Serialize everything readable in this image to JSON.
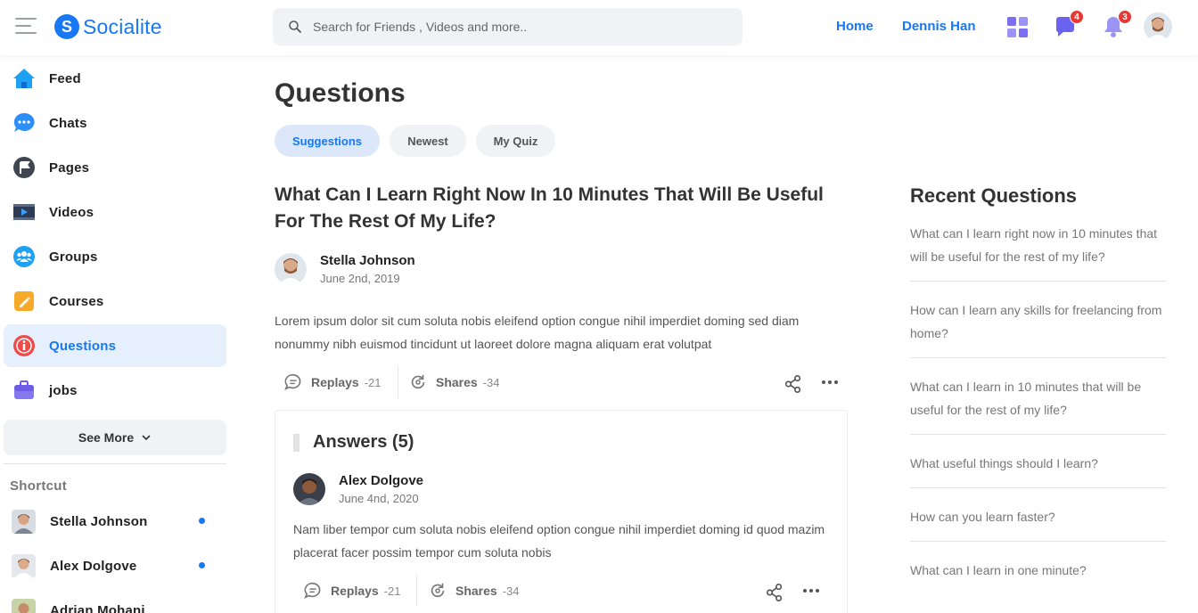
{
  "brand": {
    "name": "Socialite",
    "letter": "S",
    "color": "#1877f2"
  },
  "search": {
    "placeholder": "Search for Friends , Videos and more.."
  },
  "header": {
    "home_label": "Home",
    "user_label": "Dennis Han",
    "messages_badge": "4",
    "notifications_badge": "3"
  },
  "sidebar": {
    "items": [
      {
        "label": "Feed",
        "icon": "home-icon"
      },
      {
        "label": "Chats",
        "icon": "chat-icon"
      },
      {
        "label": "Pages",
        "icon": "flag-icon"
      },
      {
        "label": "Videos",
        "icon": "video-icon"
      },
      {
        "label": "Groups",
        "icon": "groups-icon"
      },
      {
        "label": "Courses",
        "icon": "courses-icon"
      },
      {
        "label": "Questions",
        "icon": "info-icon",
        "active": true
      },
      {
        "label": "jobs",
        "icon": "briefcase-icon"
      }
    ],
    "see_more": "See More",
    "shortcut_title": "Shortcut",
    "shortcuts": [
      {
        "name": "Stella Johnson",
        "online": true
      },
      {
        "name": "Alex Dolgove",
        "online": true
      },
      {
        "name": "Adrian Mohani",
        "online": false
      }
    ]
  },
  "main": {
    "title": "Questions",
    "tabs": [
      {
        "label": "Suggestions",
        "active": true
      },
      {
        "label": "Newest"
      },
      {
        "label": "My Quiz"
      }
    ],
    "question": {
      "title": "What Can I Learn Right Now In 10 Minutes That Will Be Useful For The Rest Of My Life?",
      "author": "Stella Johnson",
      "date": "June 2nd, 2019",
      "body": "Lorem ipsum dolor sit cum soluta nobis eleifend option congue nihil imperdiet doming sed diam nonummy nibh euismod tincidunt ut laoreet dolore magna aliquam erat volutpat",
      "replays_label": "Replays",
      "replays_count": "-21",
      "shares_label": "Shares",
      "shares_count": "-34"
    },
    "answers": {
      "title": "Answers (5)",
      "items": [
        {
          "author": "Alex Dolgove",
          "date": "June 4nd, 2020",
          "body": "Nam liber tempor cum soluta nobis eleifend option congue nihil imperdiet doming id quod mazim placerat facer possim tempor cum soluta nobis",
          "replays_label": "Replays",
          "replays_count": "-21",
          "shares_label": "Shares",
          "shares_count": "-34"
        }
      ]
    }
  },
  "recent": {
    "title": "Recent Questions",
    "items": [
      "What can I learn right now in 10 minutes that will be useful for the rest of my life?",
      "How can I learn any skills for freelancing from home?",
      "What can I learn in 10 minutes that will be useful for the rest of my life?",
      "What useful things should I learn?",
      "How can you learn faster?",
      "What can I learn in one minute?"
    ]
  }
}
